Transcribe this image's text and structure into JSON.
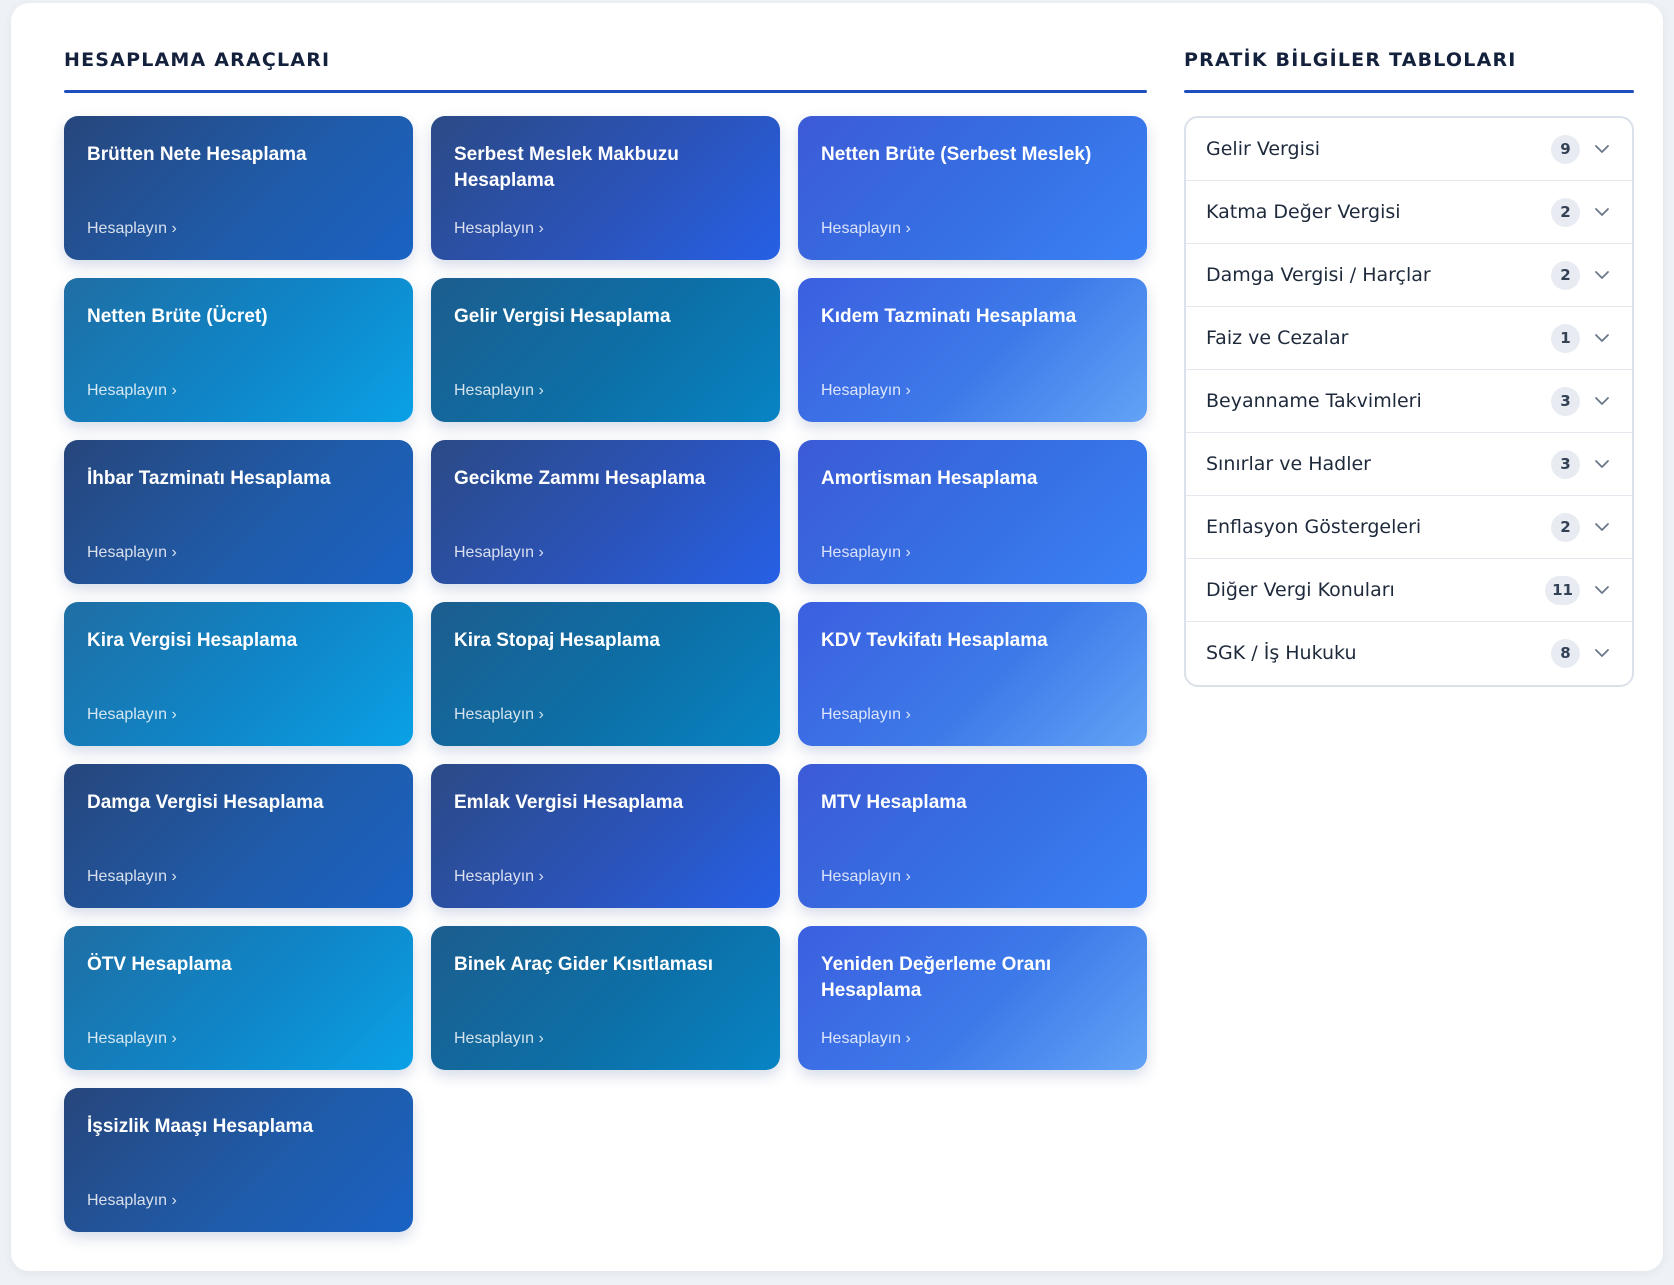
{
  "tools": {
    "title": "HESAPLAMA ARAÇLARI",
    "cards": [
      {
        "title": "Brütten Nete Hesaplama",
        "cta": "Hesaplayın ›",
        "style": "g0"
      },
      {
        "title": "Serbest Meslek Makbuzu Hesaplama",
        "cta": "Hesaplayın ›",
        "style": "g1"
      },
      {
        "title": "Netten Brüte (Serbest Meslek)",
        "cta": "Hesaplayın ›",
        "style": "g2"
      },
      {
        "title": "Netten Brüte (Ücret)",
        "cta": "Hesaplayın ›",
        "style": "g3"
      },
      {
        "title": "Gelir Vergisi Hesaplama",
        "cta": "Hesaplayın ›",
        "style": "g4"
      },
      {
        "title": "Kıdem Tazminatı Hesaplama",
        "cta": "Hesaplayın ›",
        "style": "g5"
      },
      {
        "title": "İhbar Tazminatı Hesaplama",
        "cta": "Hesaplayın ›",
        "style": "g0"
      },
      {
        "title": "Gecikme Zammı Hesaplama",
        "cta": "Hesaplayın ›",
        "style": "g1"
      },
      {
        "title": "Amortisman Hesaplama",
        "cta": "Hesaplayın ›",
        "style": "g2"
      },
      {
        "title": "Kira Vergisi Hesaplama",
        "cta": "Hesaplayın ›",
        "style": "g3"
      },
      {
        "title": "Kira Stopaj Hesaplama",
        "cta": "Hesaplayın ›",
        "style": "g4"
      },
      {
        "title": "KDV Tevkifatı Hesaplama",
        "cta": "Hesaplayın ›",
        "style": "g5"
      },
      {
        "title": "Damga Vergisi Hesaplama",
        "cta": "Hesaplayın ›",
        "style": "g0"
      },
      {
        "title": "Emlak Vergisi Hesaplama",
        "cta": "Hesaplayın ›",
        "style": "g1"
      },
      {
        "title": "MTV Hesaplama",
        "cta": "Hesaplayın ›",
        "style": "g2"
      },
      {
        "title": "ÖTV Hesaplama",
        "cta": "Hesaplayın ›",
        "style": "g3"
      },
      {
        "title": "Binek Araç Gider Kısıtlaması",
        "cta": "Hesaplayın ›",
        "style": "g4"
      },
      {
        "title": "Yeniden Değerleme Oranı Hesaplama",
        "cta": "Hesaplayın ›",
        "style": "g5"
      },
      {
        "title": "İşsizlik Maaşı Hesaplama",
        "cta": "Hesaplayın ›",
        "style": "g0"
      }
    ]
  },
  "tables": {
    "title": "PRATİK BİLGİLER TABLOLARI",
    "items": [
      {
        "label": "Gelir Vergisi",
        "count": "9"
      },
      {
        "label": "Katma Değer Vergisi",
        "count": "2"
      },
      {
        "label": "Damga Vergisi / Harçlar",
        "count": "2"
      },
      {
        "label": "Faiz ve Cezalar",
        "count": "1"
      },
      {
        "label": "Beyanname Takvimleri",
        "count": "3"
      },
      {
        "label": "Sınırlar ve Hadler",
        "count": "3"
      },
      {
        "label": "Enflasyon Göstergeleri",
        "count": "2"
      },
      {
        "label": "Diğer Vergi Konuları",
        "count": "11"
      },
      {
        "label": "SGK / İş Hukuku",
        "count": "8"
      }
    ]
  },
  "colors": {
    "accent_rule": "#1f4fbf",
    "badge_bg": "#e8ecf2"
  },
  "icons": {
    "accordion_toggle": "chevron-down-icon",
    "card_cta": "chevron-right-glyph"
  }
}
